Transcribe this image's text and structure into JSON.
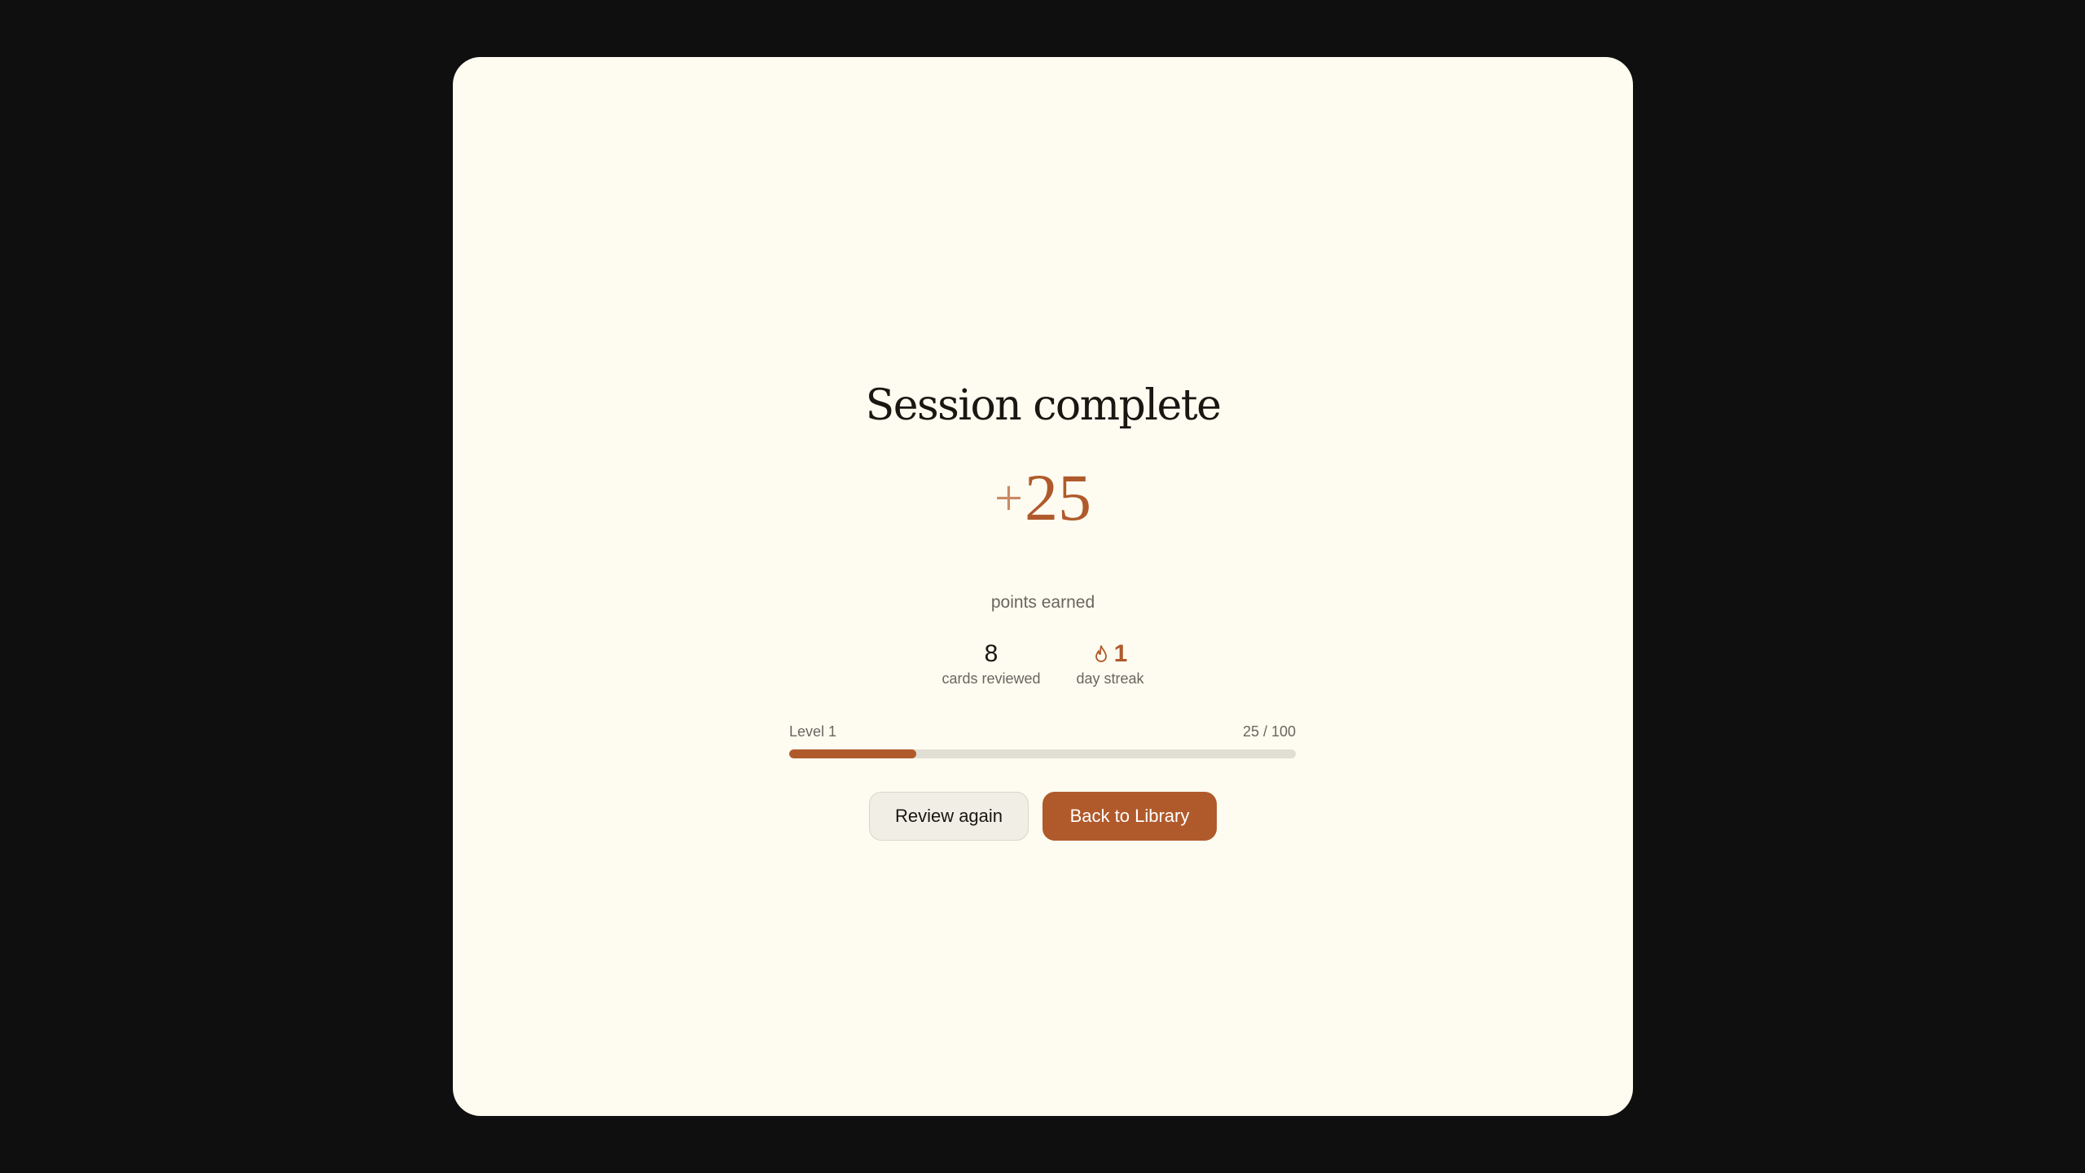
{
  "session": {
    "title": "Session complete",
    "points_prefix": "+",
    "points_value": "25",
    "points_label": "points earned"
  },
  "stats": {
    "cards": {
      "value": "8",
      "label": "cards reviewed"
    },
    "streak": {
      "value": "1",
      "label": "day streak",
      "icon": "flame-icon"
    }
  },
  "level": {
    "label": "Level 1",
    "progress_text": "25 / 100",
    "current": 25,
    "max": 100
  },
  "actions": {
    "review_again_label": "Review again",
    "back_label": "Back to Library"
  },
  "colors": {
    "accent": "#b05a2c",
    "background": "#fefcf0"
  }
}
